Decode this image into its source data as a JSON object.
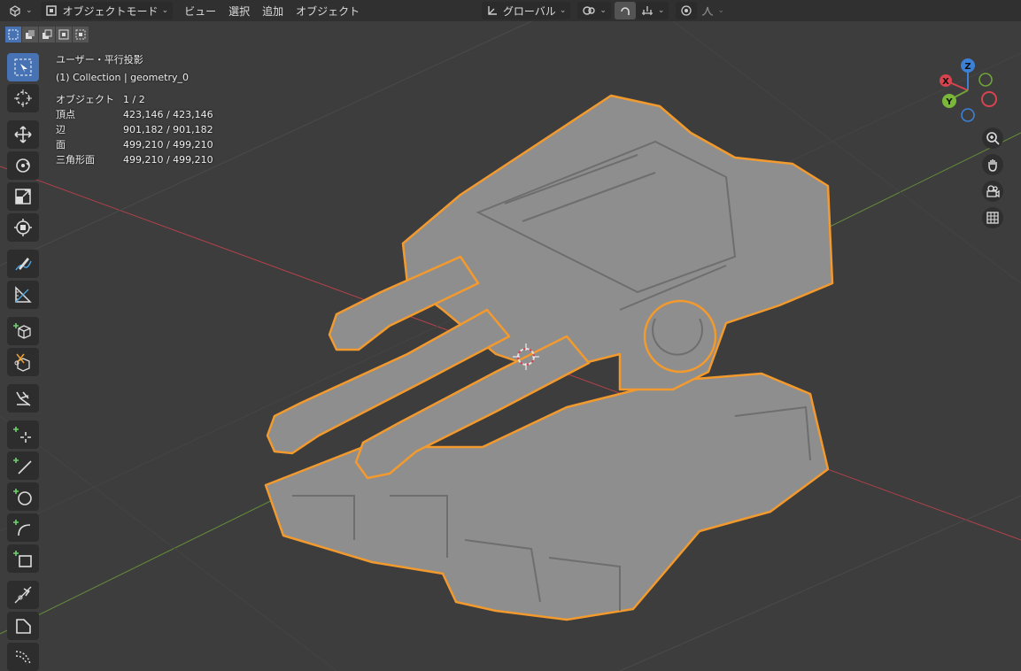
{
  "header": {
    "mode_label": "オブジェクトモード",
    "menus": [
      "ビュー",
      "選択",
      "追加",
      "オブジェクト"
    ],
    "orientation_label": "グローバル"
  },
  "overlay": {
    "view_name": "ユーザー・平行投影",
    "collection": "(1) Collection | geometry_0"
  },
  "stats": {
    "objects_label": "オブジェクト",
    "objects_value": "1 / 2",
    "vertices_label": "頂点",
    "vertices_value": "423,146 / 423,146",
    "edges_label": "辺",
    "edges_value": "901,182 / 901,182",
    "faces_label": "面",
    "faces_value": "499,210 / 499,210",
    "tris_label": "三角形面",
    "tris_value": "499,210 / 499,210"
  },
  "gizmo": {
    "x_label": "X",
    "y_label": "Y",
    "z_label": "Z"
  },
  "colors": {
    "accent": "#4772b3",
    "selection_outline": "#f29a2e",
    "axis_x": "#d8434f",
    "axis_y": "#6fa33a",
    "axis_z": "#3c81d6",
    "viewport_bg": "#3d3d3d",
    "header_bg": "#303030"
  },
  "icons": {
    "editor_type": "view3d-icon",
    "object_mode": "object-mode-icon",
    "transform_orientation": "orientation-icon",
    "pivot": "pivot-icon",
    "snap": "snap-icon",
    "proportional": "proportional-icon",
    "zoom": "zoom-icon",
    "pan": "hand-icon",
    "camera": "camera-icon",
    "ortho": "grid-icon"
  },
  "tools": [
    "select-box",
    "cursor",
    "move",
    "rotate",
    "scale",
    "transform",
    "annotate",
    "measure",
    "add-cube",
    "extrude",
    "shear",
    "vertex-add",
    "line-add",
    "circle-add",
    "arc-add",
    "rect-add",
    "knife",
    "bevel",
    "curve"
  ]
}
